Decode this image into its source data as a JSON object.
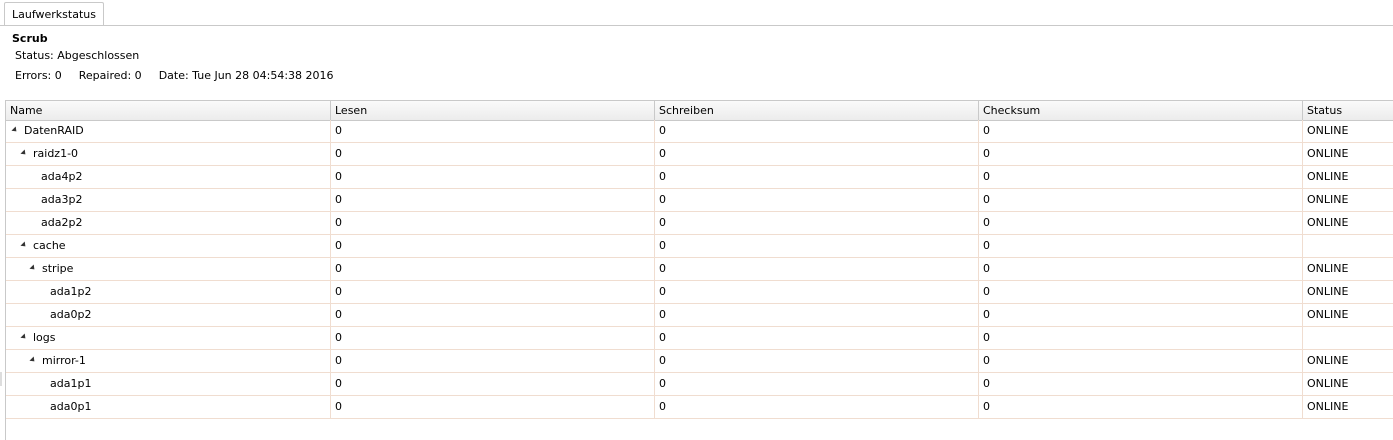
{
  "tab": {
    "label": "Laufwerkstatus"
  },
  "scrub": {
    "title": "Scrub",
    "status": "Status: Abgeschlossen",
    "errors": "Errors: 0",
    "repaired": "Repaired: 0",
    "date": "Date: Tue Jun 28 04:54:38 2016"
  },
  "columns": [
    "Name",
    "Lesen",
    "Schreiben",
    "Checksum",
    "Status"
  ],
  "rows": [
    {
      "name": "DatenRAID",
      "level": 0,
      "expandable": true,
      "read": "0",
      "write": "0",
      "checksum": "0",
      "status": "ONLINE"
    },
    {
      "name": "raidz1-0",
      "level": 1,
      "expandable": true,
      "read": "0",
      "write": "0",
      "checksum": "0",
      "status": "ONLINE"
    },
    {
      "name": "ada4p2",
      "level": 2,
      "expandable": false,
      "read": "0",
      "write": "0",
      "checksum": "0",
      "status": "ONLINE"
    },
    {
      "name": "ada3p2",
      "level": 2,
      "expandable": false,
      "read": "0",
      "write": "0",
      "checksum": "0",
      "status": "ONLINE"
    },
    {
      "name": "ada2p2",
      "level": 2,
      "expandable": false,
      "read": "0",
      "write": "0",
      "checksum": "0",
      "status": "ONLINE"
    },
    {
      "name": "cache",
      "level": 1,
      "expandable": true,
      "read": "0",
      "write": "0",
      "checksum": "0",
      "status": ""
    },
    {
      "name": "stripe",
      "level": 2,
      "expandable": true,
      "read": "0",
      "write": "0",
      "checksum": "0",
      "status": "ONLINE"
    },
    {
      "name": "ada1p2",
      "level": 3,
      "expandable": false,
      "read": "0",
      "write": "0",
      "checksum": "0",
      "status": "ONLINE"
    },
    {
      "name": "ada0p2",
      "level": 3,
      "expandable": false,
      "read": "0",
      "write": "0",
      "checksum": "0",
      "status": "ONLINE"
    },
    {
      "name": "logs",
      "level": 1,
      "expandable": true,
      "read": "0",
      "write": "0",
      "checksum": "0",
      "status": ""
    },
    {
      "name": "mirror-1",
      "level": 2,
      "expandable": true,
      "read": "0",
      "write": "0",
      "checksum": "0",
      "status": "ONLINE"
    },
    {
      "name": "ada1p1",
      "level": 3,
      "expandable": false,
      "read": "0",
      "write": "0",
      "checksum": "0",
      "status": "ONLINE"
    },
    {
      "name": "ada0p1",
      "level": 3,
      "expandable": false,
      "read": "0",
      "write": "0",
      "checksum": "0",
      "status": "ONLINE"
    }
  ],
  "colors": {
    "border": "#c9c9c9",
    "row_border": "#f0ddd0"
  },
  "icons": {
    "expander": "expanded-triangle-icon"
  }
}
